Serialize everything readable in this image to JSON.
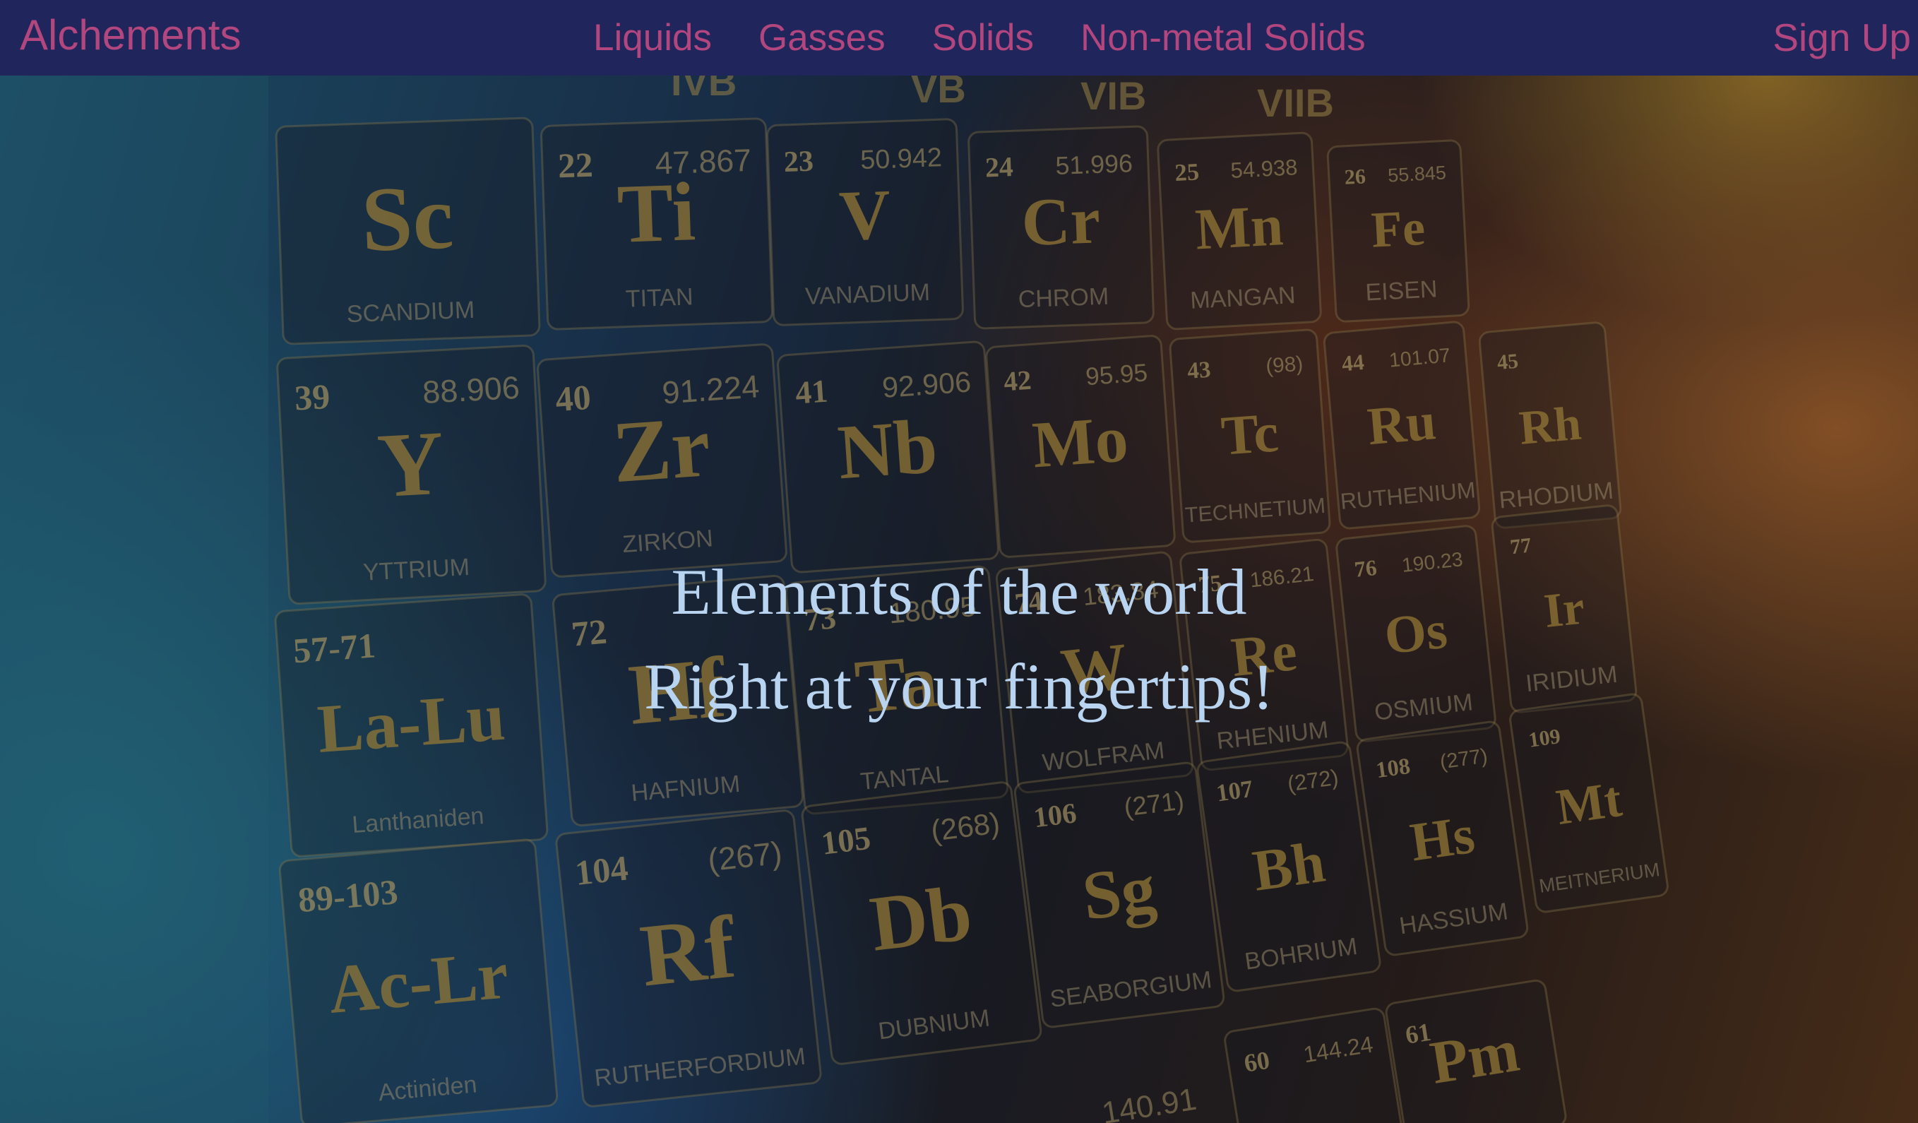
{
  "navbar": {
    "brand": "Alchements",
    "links": [
      "Liquids",
      "Gasses",
      "Solids",
      "Non-metal Solids"
    ],
    "signup": "Sign Up"
  },
  "hero": {
    "line1": "Elements of the world",
    "line2": "Right at your fingertips!"
  },
  "background": {
    "group_labels": [
      "IVB",
      "VB",
      "VIB",
      "VIIB"
    ],
    "cells": [
      {
        "num": "22",
        "mass": "47.867",
        "sym": "Ti",
        "name": "TITAN"
      },
      {
        "num": "23",
        "mass": "50.942",
        "sym": "V",
        "name": "VANADIUM"
      },
      {
        "num": "24",
        "mass": "51.996",
        "sym": "Cr",
        "name": "CHROM"
      },
      {
        "num": "25",
        "mass": "54.938",
        "sym": "Mn",
        "name": "MANGAN"
      },
      {
        "num": "26",
        "mass": "55.845",
        "sym": "Fe",
        "name": "EISEN"
      },
      {
        "num": "39",
        "mass": "88.906",
        "sym": "Y",
        "name": "YTTRIUM"
      },
      {
        "num": "40",
        "mass": "91.224",
        "sym": "Zr",
        "name": "ZIRKON"
      },
      {
        "num": "41",
        "mass": "92.906",
        "sym": "Nb",
        "name": ""
      },
      {
        "num": "42",
        "mass": "95.95",
        "sym": "Mo",
        "name": ""
      },
      {
        "num": "43",
        "mass": "(98)",
        "sym": "Tc",
        "name": "TECHNETIUM"
      },
      {
        "num": "44",
        "mass": "101.07",
        "sym": "Ru",
        "name": "RUTHENIUM"
      },
      {
        "num": "45",
        "mass": "",
        "sym": "Rh",
        "name": "RHODIUM"
      },
      {
        "num": "",
        "mass": "",
        "sym": "Sc",
        "name": "SCANDIUM"
      },
      {
        "num": "57-71",
        "mass": "",
        "sym": "La-Lu",
        "name": "Lanthaniden"
      },
      {
        "num": "72",
        "mass": "",
        "sym": "Hf",
        "name": "HAFNIUM"
      },
      {
        "num": "73",
        "mass": "180.95",
        "sym": "Ta",
        "name": "TANTAL"
      },
      {
        "num": "74",
        "mass": "183.84",
        "sym": "W",
        "name": "WOLFRAM"
      },
      {
        "num": "75",
        "mass": "186.21",
        "sym": "Re",
        "name": "RHENIUM"
      },
      {
        "num": "76",
        "mass": "190.23",
        "sym": "Os",
        "name": "OSMIUM"
      },
      {
        "num": "77",
        "mass": "",
        "sym": "Ir",
        "name": "IRIDIUM"
      },
      {
        "num": "89-103",
        "mass": "",
        "sym": "Ac-Lr",
        "name": "Actiniden"
      },
      {
        "num": "104",
        "mass": "(267)",
        "sym": "Rf",
        "name": "RUTHERFORDIUM"
      },
      {
        "num": "105",
        "mass": "(268)",
        "sym": "Db",
        "name": "DUBNIUM"
      },
      {
        "num": "106",
        "mass": "(271)",
        "sym": "Sg",
        "name": "SEABORGIUM"
      },
      {
        "num": "107",
        "mass": "(272)",
        "sym": "Bh",
        "name": "BOHRIUM"
      },
      {
        "num": "108",
        "mass": "(277)",
        "sym": "Hs",
        "name": "HASSIUM"
      },
      {
        "num": "109",
        "mass": "",
        "sym": "Mt",
        "name": "MEITNERIUM"
      },
      {
        "num": "60",
        "mass": "144.24",
        "sym": "",
        "name": ""
      },
      {
        "num": "61",
        "mass": "",
        "sym": "Pm",
        "name": ""
      }
    ],
    "bottom_mass": "140.91"
  }
}
